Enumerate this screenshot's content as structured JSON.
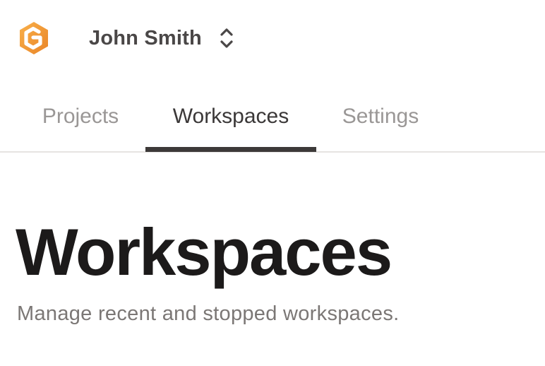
{
  "header": {
    "logo_icon": "gitpod-logo-icon",
    "brand_colors": {
      "logo_light": "#f7a645",
      "logo_dark": "#e8842a"
    },
    "user_name": "John Smith",
    "switcher_icon": "chevron-up-down-icon"
  },
  "tabs": [
    {
      "label": "Projects",
      "active": false
    },
    {
      "label": "Workspaces",
      "active": true
    },
    {
      "label": "Settings",
      "active": false
    }
  ],
  "main": {
    "title": "Workspaces",
    "subtitle": "Manage recent and stopped workspaces."
  }
}
